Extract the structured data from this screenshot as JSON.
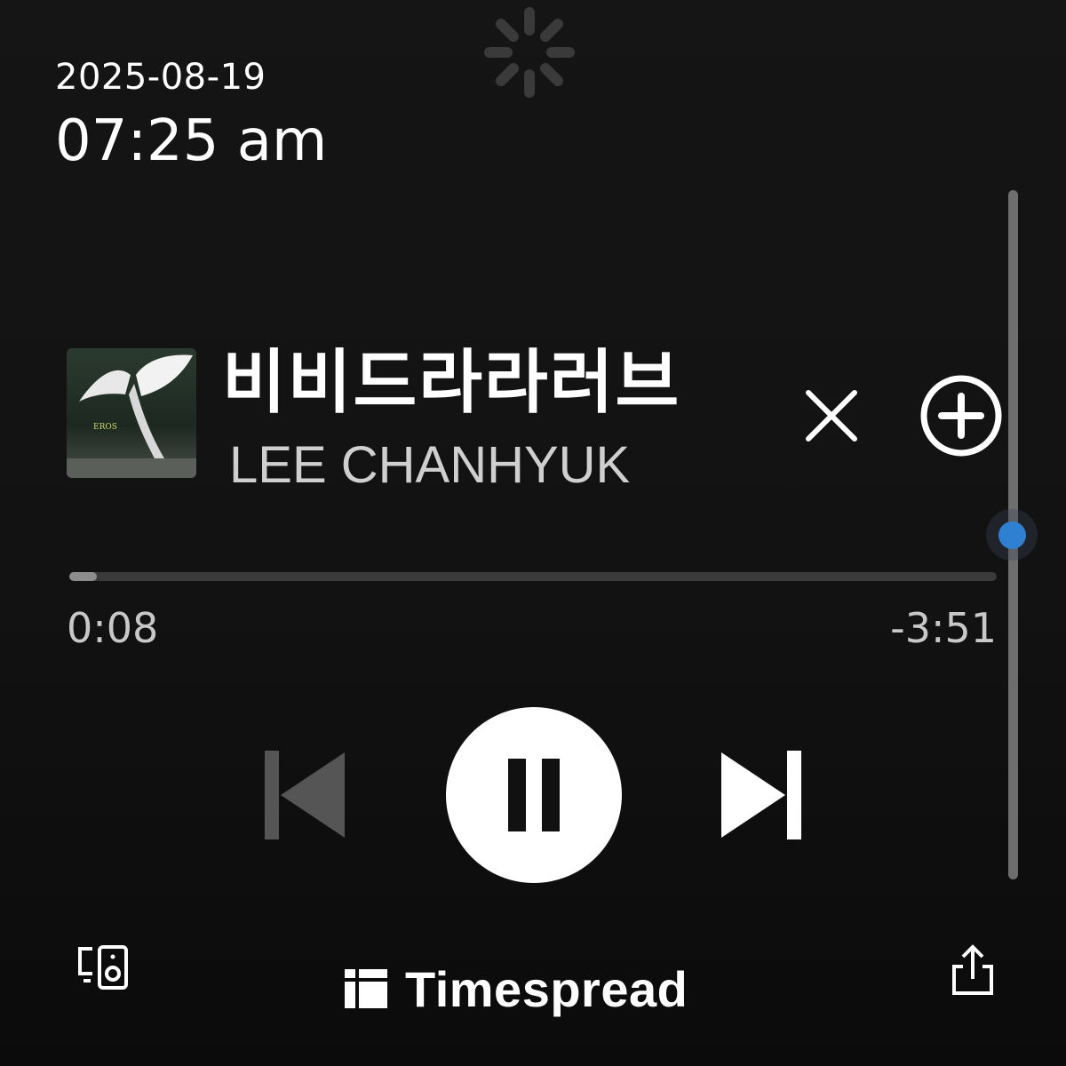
{
  "status": {
    "date": "2025-08-19",
    "time": "07:25 am",
    "loading_icon": "spinner-icon"
  },
  "now_playing": {
    "title": "비비드라라러브",
    "artist": "LEE CHANHYUK",
    "album_art_label": "EROS",
    "elapsed": "0:08",
    "remaining": "-3:51",
    "progress_fraction": 0.03
  },
  "volume": {
    "level_fraction": 0.5
  },
  "controls": {
    "close_icon": "close-icon",
    "add_icon": "add-circle-icon",
    "previous_icon": "skip-previous-icon",
    "pause_icon": "pause-icon",
    "next_icon": "skip-next-icon",
    "devices_icon": "connect-devices-icon",
    "share_icon": "share-icon"
  },
  "branding": {
    "name": "Timespread"
  },
  "colors": {
    "background": "#121212",
    "accent_volume": "#2f7fd2",
    "text_primary": "#ffffff",
    "text_secondary": "#cfcfcf",
    "progress_fill": "#8c8c8c",
    "progress_track": "#3a3a3a"
  }
}
